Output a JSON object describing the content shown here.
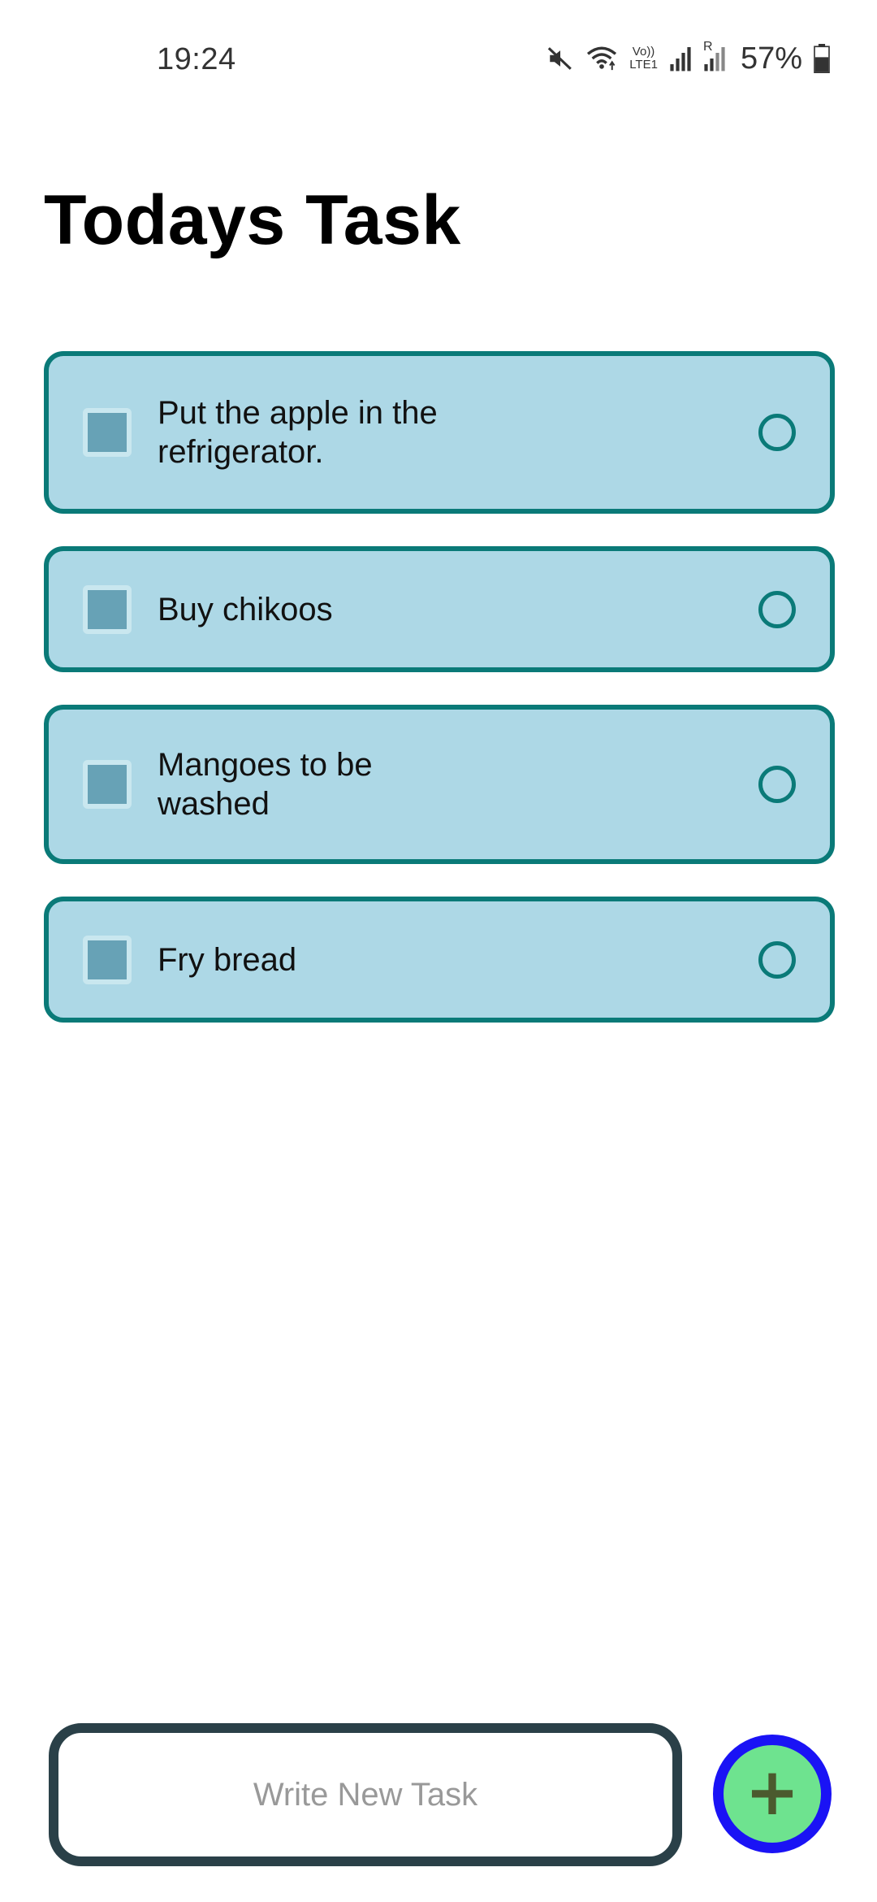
{
  "status_bar": {
    "time": "19:24",
    "battery": "57%",
    "icons": [
      "mute-icon",
      "wifi-icon",
      "volte-icon",
      "signal-icon",
      "roaming-signal-icon",
      "battery-icon"
    ],
    "volte_label_top": "Vo))",
    "volte_label_bottom": "LTE1",
    "roaming_label": "R"
  },
  "page": {
    "title": "Todays Task"
  },
  "tasks": [
    {
      "text": "Put the apple in the refrigerator."
    },
    {
      "text": "Buy chikoos"
    },
    {
      "text": "Mangoes to be washed"
    },
    {
      "text": "Fry bread"
    }
  ],
  "input": {
    "placeholder": "Write New Task",
    "value": ""
  },
  "add_button": {
    "label": "+"
  },
  "colors": {
    "card_bg": "#add8e6",
    "card_border": "#0a7a78",
    "input_border": "#2a4048",
    "add_button_bg": "#6ee38f",
    "add_button_border": "#1a13f5"
  }
}
